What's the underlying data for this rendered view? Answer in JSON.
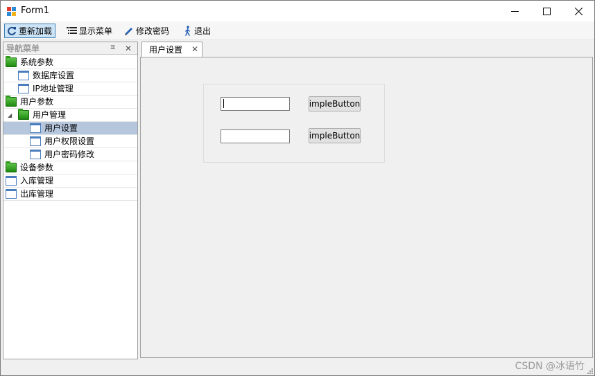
{
  "window": {
    "title": "Form1",
    "icon": "winforms-app-icon",
    "controls": [
      "minimize-icon",
      "maximize-icon",
      "close-icon"
    ]
  },
  "toolbar": {
    "items": [
      {
        "label": "重新加载",
        "icon": "refresh-icon",
        "active": true
      },
      {
        "label": "显示菜单",
        "icon": "menu-list-icon",
        "active": false
      },
      {
        "label": "修改密码",
        "icon": "pencil-icon",
        "active": false
      },
      {
        "label": "退出",
        "icon": "walking-person-icon",
        "active": false
      }
    ]
  },
  "nav": {
    "title": "导航菜单",
    "pin_glyph": "ㅍ",
    "close_glyph": "✕",
    "tree": [
      {
        "label": "系统参数",
        "icon": "folder-icon",
        "level": 0
      },
      {
        "label": "数据库设置",
        "icon": "window-icon",
        "level": 1
      },
      {
        "label": "IP地址管理",
        "icon": "window-icon",
        "level": 1
      },
      {
        "label": "用户参数",
        "icon": "folder-icon",
        "level": 0
      },
      {
        "label": "用户管理",
        "icon": "folder-icon",
        "level": 1,
        "expanded": true
      },
      {
        "label": "用户设置",
        "icon": "window-icon",
        "level": 2,
        "selected": true
      },
      {
        "label": "用户权限设置",
        "icon": "window-icon",
        "level": 2
      },
      {
        "label": "用户密码修改",
        "icon": "window-icon",
        "level": 2
      },
      {
        "label": "设备参数",
        "icon": "folder-icon",
        "level": 0
      },
      {
        "label": "入库管理",
        "icon": "window-icon",
        "level": 0
      },
      {
        "label": "出库管理",
        "icon": "window-icon",
        "level": 0
      }
    ]
  },
  "tabs": [
    {
      "label": "用户设置",
      "close_glyph": "✕",
      "active": true
    }
  ],
  "form": {
    "input1_value": "",
    "input2_value": "",
    "button1_label": "impleButton",
    "button2_label": "impleButton"
  },
  "status": {
    "watermark": "CSDN @冰语竹"
  },
  "colors": {
    "selection": "#b6c6dd",
    "toolbar_active_bg": "#cce4f7",
    "toolbar_active_border": "#3c7fb1"
  }
}
